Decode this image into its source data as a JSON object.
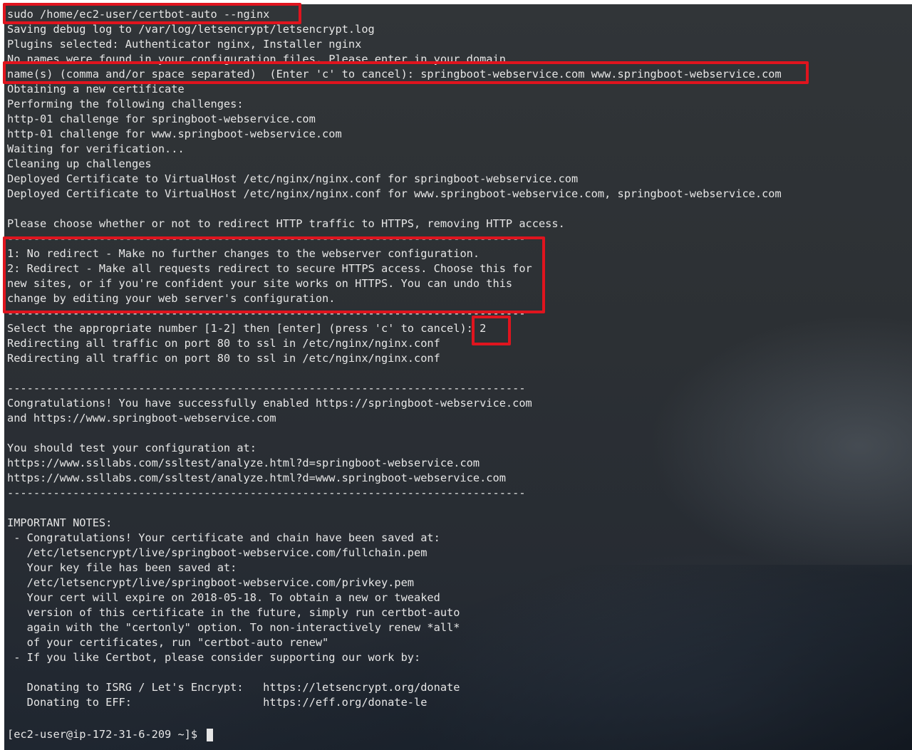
{
  "terminal": {
    "lines": [
      "sudo /home/ec2-user/certbot-auto --nginx",
      "Saving debug log to /var/log/letsencrypt/letsencrypt.log",
      "Plugins selected: Authenticator nginx, Installer nginx",
      "No names were found in your configuration files. Please enter in your domain",
      "name(s) (comma and/or space separated)  (Enter 'c' to cancel): springboot-webservice.com www.springboot-webservice.com",
      "Obtaining a new certificate",
      "Performing the following challenges:",
      "http-01 challenge for springboot-webservice.com",
      "http-01 challenge for www.springboot-webservice.com",
      "Waiting for verification...",
      "Cleaning up challenges",
      "Deployed Certificate to VirtualHost /etc/nginx/nginx.conf for springboot-webservice.com",
      "Deployed Certificate to VirtualHost /etc/nginx/nginx.conf for www.springboot-webservice.com, springboot-webservice.com",
      "",
      "Please choose whether or not to redirect HTTP traffic to HTTPS, removing HTTP access.",
      "-------------------------------------------------------------------------------",
      "1: No redirect - Make no further changes to the webserver configuration.",
      "2: Redirect - Make all requests redirect to secure HTTPS access. Choose this for",
      "new sites, or if you're confident your site works on HTTPS. You can undo this",
      "change by editing your web server's configuration.",
      "-------------------------------------------------------------------------------",
      "Select the appropriate number [1-2] then [enter] (press 'c' to cancel): 2",
      "Redirecting all traffic on port 80 to ssl in /etc/nginx/nginx.conf",
      "Redirecting all traffic on port 80 to ssl in /etc/nginx/nginx.conf",
      "",
      "-------------------------------------------------------------------------------",
      "Congratulations! You have successfully enabled https://springboot-webservice.com",
      "and https://www.springboot-webservice.com",
      "",
      "You should test your configuration at:",
      "https://www.ssllabs.com/ssltest/analyze.html?d=springboot-webservice.com",
      "https://www.ssllabs.com/ssltest/analyze.html?d=www.springboot-webservice.com",
      "-------------------------------------------------------------------------------",
      "",
      "IMPORTANT NOTES:",
      " - Congratulations! Your certificate and chain have been saved at:",
      "   /etc/letsencrypt/live/springboot-webservice.com/fullchain.pem",
      "   Your key file has been saved at:",
      "   /etc/letsencrypt/live/springboot-webservice.com/privkey.pem",
      "   Your cert will expire on 2018-05-18. To obtain a new or tweaked",
      "   version of this certificate in the future, simply run certbot-auto",
      "   again with the \"certonly\" option. To non-interactively renew *all*",
      "   of your certificates, run \"certbot-auto renew\"",
      " - If you like Certbot, please consider supporting our work by:",
      "",
      "   Donating to ISRG / Let's Encrypt:   https://letsencrypt.org/donate",
      "   Donating to EFF:                    https://eff.org/donate-le",
      "",
      "[ec2-user@ip-172-31-6-209 ~]$ "
    ]
  },
  "highlights": {
    "color": "#e0141e",
    "items": [
      "command",
      "domain-input",
      "redirect-options",
      "selection-answer"
    ]
  },
  "colors": {
    "text": "#e6e6e6",
    "background": "#2e3236"
  }
}
